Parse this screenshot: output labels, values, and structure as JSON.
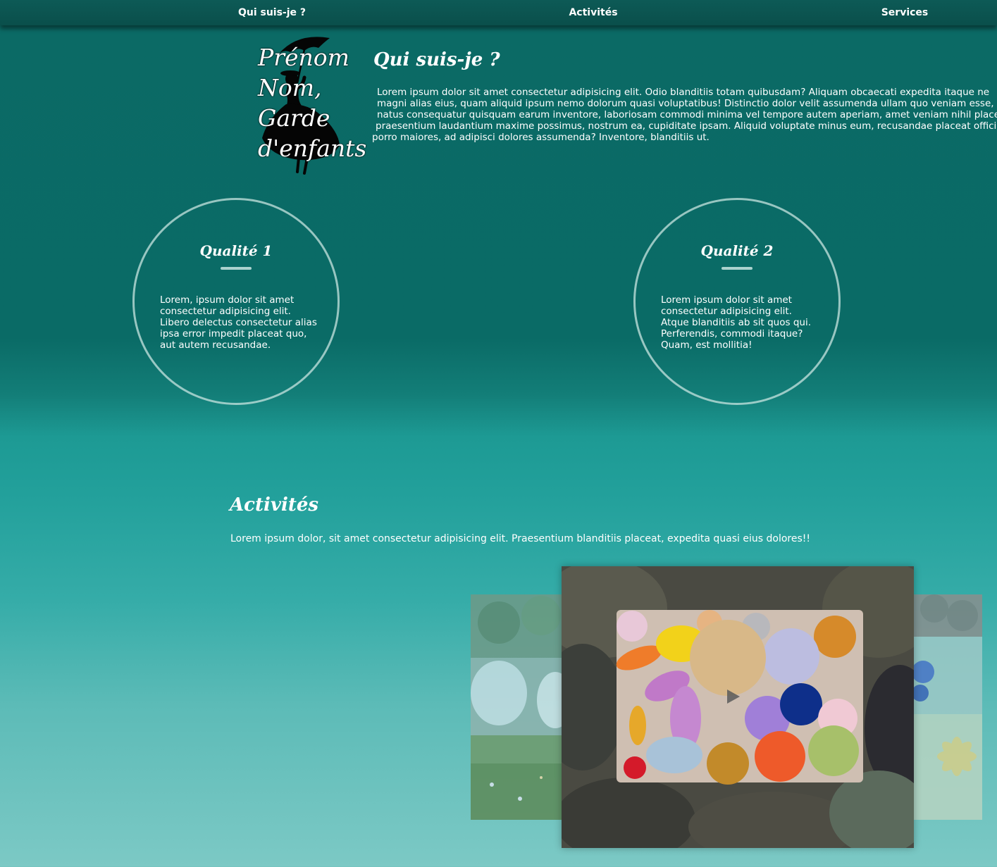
{
  "nav": {
    "items": [
      {
        "label": "Qui suis-je ?"
      },
      {
        "label": "Activités"
      },
      {
        "label": "Services"
      }
    ]
  },
  "logo": {
    "lines": [
      "Prénom",
      "Nom,",
      "Garde",
      "d'enfants"
    ],
    "icon": "umbrella-lady-silhouette-icon"
  },
  "about": {
    "title": "Qui suis-je ?",
    "lines": [
      "Lorem ipsum dolor sit amet consectetur adipisicing elit. Odio blanditiis totam quibusdam? Aliquam obcaecati expedita itaque ne",
      "magni alias eius, quam aliquid ipsum nemo dolorum quasi voluptatibus! Distinctio dolor velit assumenda ullam quo veniam esse, c",
      "natus consequatur quisquam earum inventore, laboriosam commodi minima vel tempore autem aperiam, amet veniam nihil place",
      "praesentium laudantium maxime possimus, nostrum ea, cupiditate ipsam. Aliquid voluptate minus eum, recusandae placeat officia",
      "porro maiores, ad adipisci dolores assumenda? Inventore, blanditiis ut."
    ]
  },
  "qualities": [
    {
      "title": "Qualité 1",
      "lines": [
        "Lorem, ipsum dolor sit amet",
        "consectetur adipisicing elit.",
        "Libero delectus consectetur alias",
        "ipsa error impedit placeat quo,",
        "aut autem recusandae."
      ]
    },
    {
      "title": "Qualité 2",
      "lines": [
        "Lorem ipsum dolor sit amet",
        "consectetur adipisicing elit.",
        "Atque blanditiis ab sit quos qui.",
        "Perferendis, commodi itaque?",
        "Quam, est mollitia!"
      ]
    }
  ],
  "activities": {
    "title": "Activités",
    "text": "Lorem ipsum dolor, sit amet consectetur adipisicing elit. Praesentium blanditiis placeat, expedita quasi eius dolores!!",
    "carousel": {
      "play_icon": "play-icon"
    }
  }
}
